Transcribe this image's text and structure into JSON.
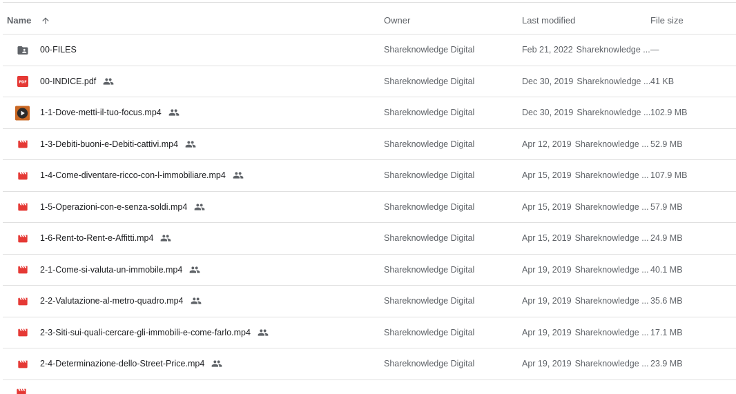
{
  "columns": {
    "name": "Name",
    "owner": "Owner",
    "modified": "Last modified",
    "size": "File size"
  },
  "colors": {
    "video_icon": "#e53935",
    "pdf_icon": "#e53935",
    "folder_icon": "#5f6368"
  },
  "rows": [
    {
      "name": "00-FILES",
      "icon": "folder-shared-icon",
      "shared": false,
      "owner": "Shareknowledge Digital",
      "date": "Feb 21, 2022",
      "by": "Shareknowledge ...",
      "size": "—"
    },
    {
      "name": "00-INDICE.pdf",
      "icon": "pdf-icon",
      "shared": true,
      "owner": "Shareknowledge Digital",
      "date": "Dec 30, 2019",
      "by": "Shareknowledge ...",
      "size": "41 KB"
    },
    {
      "name": "1-1-Dove-metti-il-tuo-focus.mp4",
      "icon": "video-thumbnail-icon",
      "shared": true,
      "owner": "Shareknowledge Digital",
      "date": "Dec 30, 2019",
      "by": "Shareknowledge ...",
      "size": "102.9 MB"
    },
    {
      "name": "1-3-Debiti-buoni-e-Debiti-cattivi.mp4",
      "icon": "video-icon",
      "shared": true,
      "owner": "Shareknowledge Digital",
      "date": "Apr 12, 2019",
      "by": "Shareknowledge ...",
      "size": "52.9 MB"
    },
    {
      "name": "1-4-Come-diventare-ricco-con-l-immobiliare.mp4",
      "icon": "video-icon",
      "shared": true,
      "owner": "Shareknowledge Digital",
      "date": "Apr 15, 2019",
      "by": "Shareknowledge ...",
      "size": "107.9 MB"
    },
    {
      "name": "1-5-Operazioni-con-e-senza-soldi.mp4",
      "icon": "video-icon",
      "shared": true,
      "owner": "Shareknowledge Digital",
      "date": "Apr 15, 2019",
      "by": "Shareknowledge ...",
      "size": "57.9 MB"
    },
    {
      "name": "1-6-Rent-to-Rent-e-Affitti.mp4",
      "icon": "video-icon",
      "shared": true,
      "owner": "Shareknowledge Digital",
      "date": "Apr 15, 2019",
      "by": "Shareknowledge ...",
      "size": "24.9 MB"
    },
    {
      "name": "2-1-Come-si-valuta-un-immobile.mp4",
      "icon": "video-icon",
      "shared": true,
      "owner": "Shareknowledge Digital",
      "date": "Apr 19, 2019",
      "by": "Shareknowledge ...",
      "size": "40.1 MB"
    },
    {
      "name": "2-2-Valutazione-al-metro-quadro.mp4",
      "icon": "video-icon",
      "shared": true,
      "owner": "Shareknowledge Digital",
      "date": "Apr 19, 2019",
      "by": "Shareknowledge ...",
      "size": "35.6 MB"
    },
    {
      "name": "2-3-Siti-sui-quali-cercare-gli-immobili-e-come-farlo.mp4",
      "icon": "video-icon",
      "shared": true,
      "owner": "Shareknowledge Digital",
      "date": "Apr 19, 2019",
      "by": "Shareknowledge ...",
      "size": "17.1 MB"
    },
    {
      "name": "2-4-Determinazione-dello-Street-Price.mp4",
      "icon": "video-icon",
      "shared": true,
      "owner": "Shareknowledge Digital",
      "date": "Apr 19, 2019",
      "by": "Shareknowledge ...",
      "size": "23.9 MB"
    }
  ]
}
